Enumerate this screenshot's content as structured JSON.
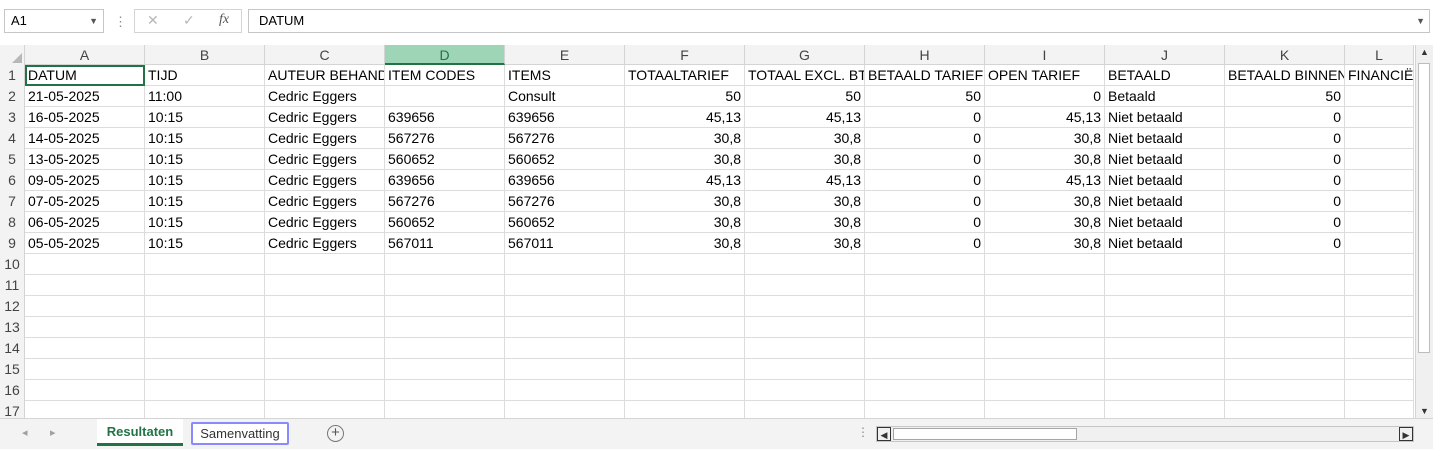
{
  "formula_bar": {
    "name_box": "A1",
    "formula_value": "DATUM",
    "cancel_glyph": "✕",
    "enter_glyph": "✓",
    "fx_label": "fx",
    "separator": "⋮"
  },
  "columns": [
    "A",
    "B",
    "C",
    "D",
    "E",
    "F",
    "G",
    "H",
    "I",
    "J",
    "K",
    "L"
  ],
  "selected_column": "D",
  "active_cell": "A1",
  "row_numbers": [
    "1",
    "2",
    "3",
    "4",
    "5",
    "6",
    "7",
    "8",
    "9",
    "10",
    "11",
    "12",
    "13",
    "14",
    "15",
    "16",
    "17"
  ],
  "table": {
    "headers": [
      "DATUM",
      "TIJD",
      "AUTEUR BEHANDELAAR",
      "ITEM CODES",
      "ITEMS",
      "TOTAALTARIEF",
      "TOTAAL EXCL. BTW",
      "BETAALD TARIEF",
      "OPEN TARIEF",
      "BETAALD",
      "BETAALD BINNEN",
      "FINANCIËN"
    ],
    "rows": [
      [
        "21-05-2025",
        "11:00",
        "Cedric  Eggers",
        "",
        "Consult",
        "50",
        "50",
        "50",
        "0",
        "Betaald",
        "50",
        ""
      ],
      [
        "16-05-2025",
        "10:15",
        "Cedric  Eggers",
        "639656",
        "639656",
        "45,13",
        "45,13",
        "0",
        "45,13",
        "Niet betaald",
        "0",
        ""
      ],
      [
        "14-05-2025",
        "10:15",
        "Cedric  Eggers",
        "567276",
        "567276",
        "30,8",
        "30,8",
        "0",
        "30,8",
        "Niet betaald",
        "0",
        ""
      ],
      [
        "13-05-2025",
        "10:15",
        "Cedric  Eggers",
        "560652",
        "560652",
        "30,8",
        "30,8",
        "0",
        "30,8",
        "Niet betaald",
        "0",
        ""
      ],
      [
        "09-05-2025",
        "10:15",
        "Cedric  Eggers",
        "639656",
        "639656",
        "45,13",
        "45,13",
        "0",
        "45,13",
        "Niet betaald",
        "0",
        ""
      ],
      [
        "07-05-2025",
        "10:15",
        "Cedric  Eggers",
        "567276",
        "567276",
        "30,8",
        "30,8",
        "0",
        "30,8",
        "Niet betaald",
        "0",
        ""
      ],
      [
        "06-05-2025",
        "10:15",
        "Cedric  Eggers",
        "560652",
        "560652",
        "30,8",
        "30,8",
        "0",
        "30,8",
        "Niet betaald",
        "0",
        ""
      ],
      [
        "05-05-2025",
        "10:15",
        "Cedric  Eggers",
        "567011",
        "567011",
        "30,8",
        "30,8",
        "0",
        "30,8",
        "Niet betaald",
        "0",
        ""
      ]
    ],
    "numeric_columns": [
      "F",
      "G",
      "H",
      "I",
      "K"
    ]
  },
  "sheets": {
    "active": "Resultaten",
    "tabs": [
      "Resultaten",
      "Samenvatting"
    ],
    "add_glyph": "+"
  },
  "colors": {
    "accent": "#217346",
    "selected_header": "#9fd5b7",
    "focus_outline": "#8a8aff"
  },
  "icons": {
    "name_box_dropdown": "chevron-down-icon",
    "cancel": "close-icon",
    "enter": "check-icon",
    "function": "fx-icon",
    "add_sheet": "plus-circle-icon"
  }
}
